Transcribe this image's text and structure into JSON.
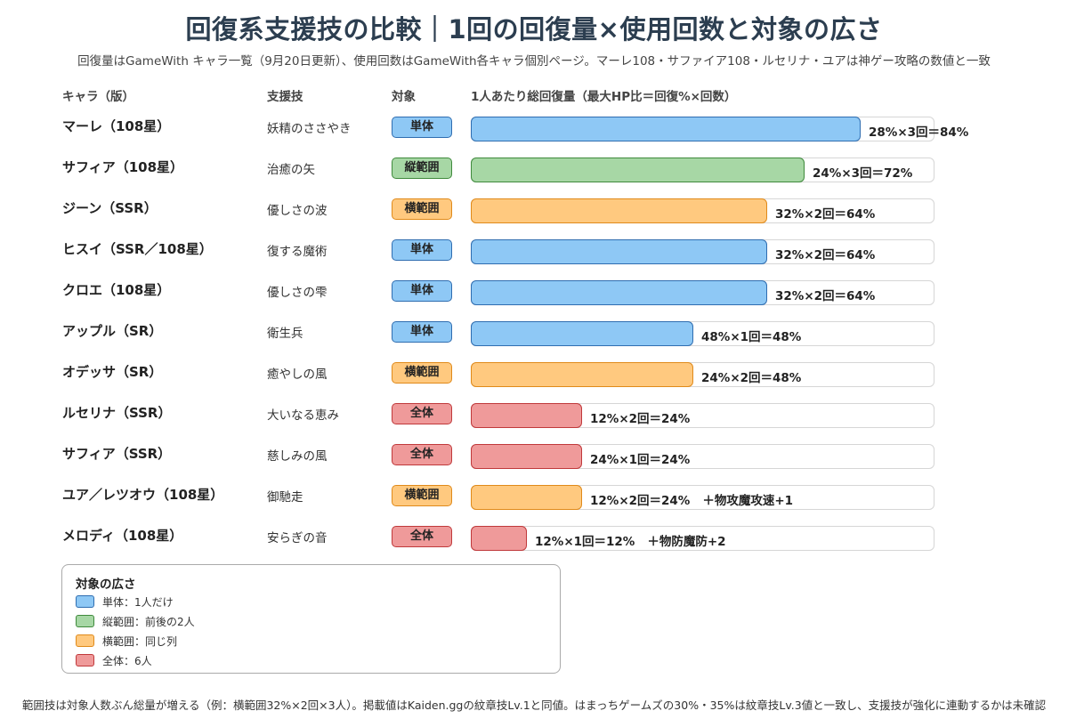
{
  "title": "回復系支援技の比較｜1回の回復量×使用回数と対象の広さ",
  "subtitle": "回復量はGameWith キャラ一覧（9月20日更新）、使用回数はGameWith各キャラ個別ページ。マーレ108・サファイア108・ルセリナ・ユアは神ゲー攻略の数値と一致",
  "headers": {
    "character": "キャラ（版）",
    "skill": "支援技",
    "target": "対象",
    "total": "1人あたり総回復量（最大HP比＝回復%×回数）"
  },
  "target_styles": {
    "単体": {
      "fill": "#8ec8f5",
      "border": "#2f6db0"
    },
    "縦範囲": {
      "fill": "#a7d7a5",
      "border": "#3f8a3c"
    },
    "横範囲": {
      "fill": "#ffc97f",
      "border": "#e08a1a"
    },
    "全体": {
      "fill": "#ef9a9a",
      "border": "#c0393b"
    }
  },
  "legend": {
    "title": "対象の広さ",
    "items": [
      {
        "key": "単体",
        "label": "単体：1人だけ"
      },
      {
        "key": "縦範囲",
        "label": "縦範囲：前後の2人"
      },
      {
        "key": "横範囲",
        "label": "横範囲：同じ列"
      },
      {
        "key": "全体",
        "label": "全体：6人"
      }
    ]
  },
  "footnote": "範囲技は対象人数ぶん総量が増える（例：横範囲32%×2回×3人）。掲載値はKaiden.ggの紋章技Lv.1と同値。はまっちゲームズの30%・35%は紋章技Lv.3値と一致し、支援技が強化に連動するかは未確認",
  "chart_data": {
    "type": "bar",
    "orientation": "horizontal",
    "xlim": [
      0,
      100
    ],
    "rows": [
      {
        "character": "マーレ（108星）",
        "skill": "妖精のささやき",
        "target": "単体",
        "value": 84,
        "label": "28%×3回＝84%",
        "extra": ""
      },
      {
        "character": "サフィア（108星）",
        "skill": "治癒の矢",
        "target": "縦範囲",
        "value": 72,
        "label": "24%×3回＝72%",
        "extra": ""
      },
      {
        "character": "ジーン（SSR）",
        "skill": "優しさの波",
        "target": "横範囲",
        "value": 64,
        "label": "32%×2回＝64%",
        "extra": ""
      },
      {
        "character": "ヒスイ（SSR／108星）",
        "skill": "復する魔術",
        "target": "単体",
        "value": 64,
        "label": "32%×2回＝64%",
        "extra": ""
      },
      {
        "character": "クロエ（108星）",
        "skill": "優しさの雫",
        "target": "単体",
        "value": 64,
        "label": "32%×2回＝64%",
        "extra": ""
      },
      {
        "character": "アップル（SR）",
        "skill": "衛生兵",
        "target": "単体",
        "value": 48,
        "label": "48%×1回＝48%",
        "extra": ""
      },
      {
        "character": "オデッサ（SR）",
        "skill": "癒やしの風",
        "target": "横範囲",
        "value": 48,
        "label": "24%×2回＝48%",
        "extra": ""
      },
      {
        "character": "ルセリナ（SSR）",
        "skill": "大いなる恵み",
        "target": "全体",
        "value": 24,
        "label": "12%×2回＝24%",
        "extra": ""
      },
      {
        "character": "サフィア（SSR）",
        "skill": "慈しみの風",
        "target": "全体",
        "value": 24,
        "label": "24%×1回＝24%",
        "extra": ""
      },
      {
        "character": "ユア／レツオウ（108星）",
        "skill": "御馳走",
        "target": "横範囲",
        "value": 24,
        "label": "12%×2回＝24%",
        "extra": "＋物攻魔攻速+1"
      },
      {
        "character": "メロディ（108星）",
        "skill": "安らぎの音",
        "target": "全体",
        "value": 12,
        "label": "12%×1回＝12%",
        "extra": "＋物防魔防+2"
      }
    ]
  }
}
